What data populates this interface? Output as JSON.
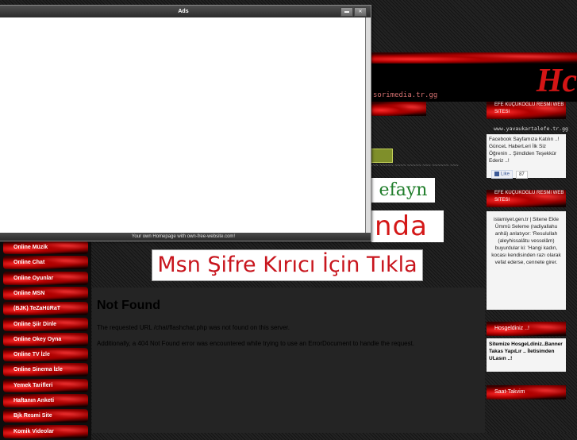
{
  "banner": {
    "url_text": "sorimedia.tr.gg",
    "letter": "Hc"
  },
  "dialog": {
    "title": "Ads",
    "footer": "Your own Homepage with own-free-website.com!"
  },
  "menu": [
    "Online Müzik",
    "Online Chat",
    "Online Oyunlar",
    "Online MSN",
    "(BJK) TeZaHüRaT",
    "Online Şiir Dinle",
    "Online Okey Oyna",
    "Online TV İzle",
    "Online Sinema İzle",
    "Yemek Tarifleri",
    "Haftanın Anketi",
    "Bjk Resmi Site",
    "Komik Videolar"
  ],
  "ads": {
    "efayn": "efayn",
    "nda": "nda",
    "msn": "Msn Şifre Kırıcı İçin Tıkla"
  },
  "content": {
    "title": "Not Found",
    "p1": "The requested URL /chat/flashchat.php was not found on this server.",
    "p2": "Additionally, a 404 Not Found error was encountered while trying to use an ErrorDocument to handle the request."
  },
  "right": {
    "head1": "efe küçükoğlu resmi web sitesi",
    "site_url": "www.yavaukartalefe.tr.gg",
    "fb_text": "Facebook Sayfamıza Katılın ..! GüncеL HaberLeri İlk Siz Öğrenin .. Şimdiden Teşekkür Ederiz ..!",
    "fb_like": "Like",
    "fb_count": "87",
    "head2": "efe küçükoğlu resmi web sitesi",
    "islam_text": "islamiyet.gen.tr | Sitene Ekle Ümmü Seleme (radiyallahu anhâ) anlatıyor: 'Resulullah (aleyhissalâtu vesselâm) buyurdular ki: 'Hangi kadın, kocası kendisinden razı olarak vefat ederse, cennete girer.",
    "head3": "Hosgeldiniz ..!",
    "welcome_text": "Sitemize HosgeLdiniz..Banner Takas YapıLır .. İletisimden ULasın ..!",
    "head4": "Saat-Takvim"
  },
  "colors": {
    "accent": "#d41515",
    "ad_green": "#1f7d2a"
  }
}
